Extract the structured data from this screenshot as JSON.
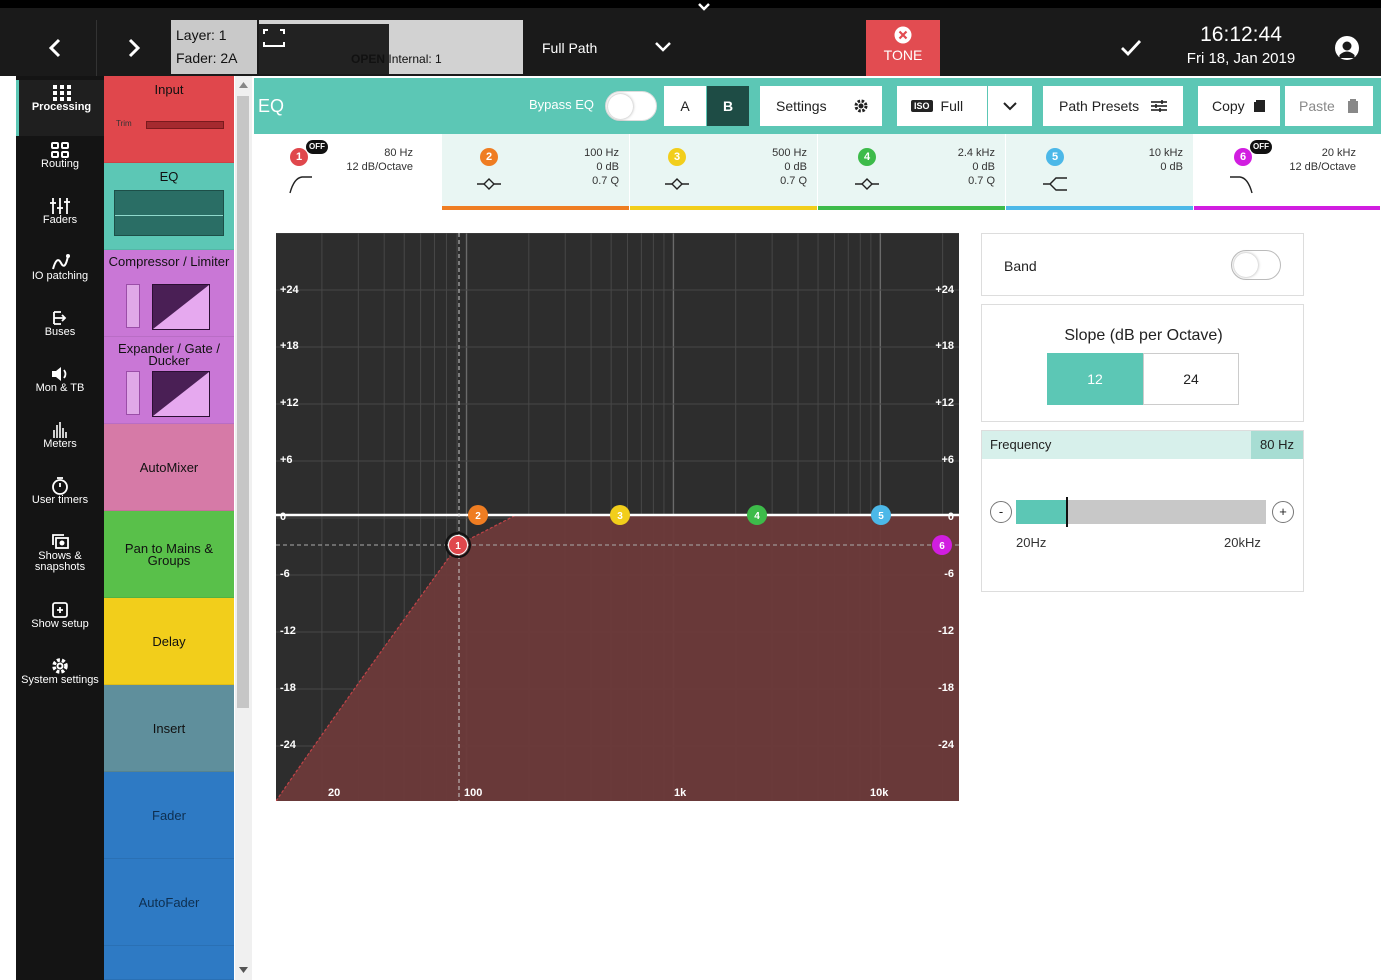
{
  "topbar": {
    "layer_label": "Layer: 1",
    "fader_label": "Fader: 2A",
    "open_label": "OPEN",
    "input_source": "Internal: 1",
    "path_mode": "Full Path",
    "tone_label": "TONE",
    "clock": "16:12:44",
    "date": "Fri 18, Jan 2019"
  },
  "sidebar": {
    "items": [
      {
        "label": "Processing",
        "icon": "grid-icon"
      },
      {
        "label": "Routing",
        "icon": "routing-icon"
      },
      {
        "label": "Faders",
        "icon": "faders-icon"
      },
      {
        "label": "IO patching",
        "icon": "patch-cable-icon"
      },
      {
        "label": "Buses",
        "icon": "bus-icon"
      },
      {
        "label": "Mon & TB",
        "icon": "speaker-icon"
      },
      {
        "label": "Meters",
        "icon": "meters-icon"
      },
      {
        "label": "User timers",
        "icon": "timer-icon"
      },
      {
        "label": "Shows & snapshots",
        "icon": "snapshot-icon"
      },
      {
        "label": "Show setup",
        "icon": "show-setup-icon"
      },
      {
        "label": "System settings",
        "icon": "gear-icon"
      }
    ]
  },
  "strip": {
    "input": "Input",
    "trim": "Trim",
    "eq": "EQ",
    "compressor": "Compressor / Limiter",
    "expander": "Expander / Gate / Ducker",
    "automixer": "AutoMixer",
    "pan": "Pan to Mains & Groups",
    "delay": "Delay",
    "insert": "Insert",
    "fader": "Fader",
    "autofader": "AutoFader",
    "colors": {
      "input": "#e0474c",
      "eq": "#5cc7b5",
      "dyn": "#c977d6",
      "automixer": "#d67aa7",
      "pan": "#59c04a",
      "delay": "#f2ce1b",
      "insert": "#5f8f9c",
      "fader": "#2e7ac4"
    }
  },
  "eq_header": {
    "title": "EQ",
    "bypass_label": "Bypass EQ",
    "bypass_on": false,
    "ab": [
      "A",
      "B"
    ],
    "ab_selected": "B",
    "settings_label": "Settings",
    "iso_badge": "ISO",
    "view_mode": "Full",
    "path_presets_label": "Path Presets",
    "copy_label": "Copy",
    "paste_label": "Paste"
  },
  "bands": [
    {
      "num": "1",
      "off": true,
      "color": "#e0474c",
      "line1": "80 Hz",
      "line2": "12 dB/Octave",
      "line3": "",
      "shape": "high-pass-icon"
    },
    {
      "num": "2",
      "off": false,
      "color": "#ef7d22",
      "line1": "100 Hz",
      "line2": "0 dB",
      "line3": "0.7 Q",
      "shape": "bell-icon"
    },
    {
      "num": "3",
      "off": false,
      "color": "#f2ce1b",
      "line1": "500 Hz",
      "line2": "0 dB",
      "line3": "0.7 Q",
      "shape": "bell-icon"
    },
    {
      "num": "4",
      "off": false,
      "color": "#3dbb4a",
      "line1": "2.4 kHz",
      "line2": "0 dB",
      "line3": "0.7 Q",
      "shape": "bell-icon"
    },
    {
      "num": "5",
      "off": false,
      "color": "#4cb8e8",
      "line1": "10 kHz",
      "line2": "0 dB",
      "line3": "",
      "shape": "high-shelf-icon"
    },
    {
      "num": "6",
      "off": true,
      "color": "#d11ee0",
      "line1": "20 kHz",
      "line2": "12 dB/Octave",
      "line3": "",
      "shape": "low-pass-icon"
    }
  ],
  "off_badge": "OFF",
  "graph": {
    "y_ticks": [
      "+24",
      "+18",
      "+12",
      "+6",
      "0",
      "-6",
      "-12",
      "-18",
      "-24"
    ],
    "x_ticks": [
      "20",
      "100",
      "1k",
      "10k"
    ]
  },
  "panel": {
    "band_label": "Band",
    "band_on": false,
    "slope_title": "Slope (dB per Octave)",
    "slope_options": [
      "12",
      "24"
    ],
    "slope_selected": "12",
    "freq_label": "Frequency",
    "freq_value": "80 Hz",
    "freq_fraction": 0.2,
    "min_label": "20Hz",
    "max_label": "20kHz",
    "minus": "-",
    "plus": "+"
  }
}
